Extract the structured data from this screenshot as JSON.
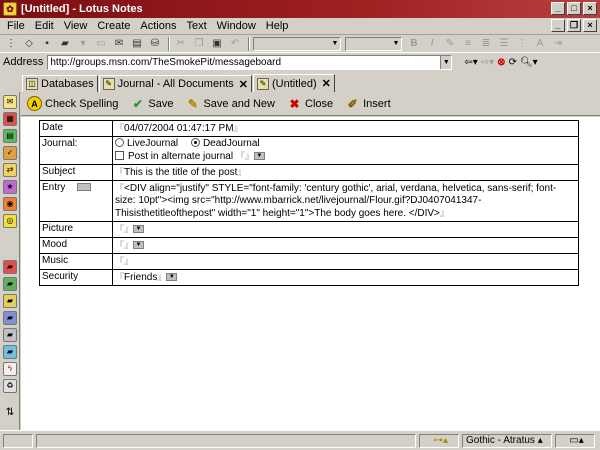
{
  "window": {
    "title": "[Untitled] - Lotus Notes"
  },
  "menu": [
    "File",
    "Edit",
    "View",
    "Create",
    "Actions",
    "Text",
    "Window",
    "Help"
  ],
  "address": {
    "label": "Address",
    "value": "http://groups.msn.com/TheSmokePit/messageboard"
  },
  "tabs": [
    {
      "label": "Databases",
      "icon": "databases-icon"
    },
    {
      "label": "Journal - All Documents",
      "icon": "journal-icon"
    },
    {
      "label": "(Untitled)",
      "icon": "document-icon"
    }
  ],
  "actions": {
    "check_spelling": "Check Spelling",
    "save": "Save",
    "save_and_new": "Save and New",
    "close": "Close",
    "insert": "Insert"
  },
  "form": {
    "date": {
      "label": "Date",
      "value": "04/07/2004 01:47:17 PM"
    },
    "journal": {
      "label": "Journal:",
      "options": [
        "LiveJournal",
        "DeadJournal"
      ],
      "selected": "DeadJournal",
      "alt_label": "Post in alternate journal"
    },
    "subject": {
      "label": "Subject",
      "value": "This is the title of the post"
    },
    "entry": {
      "label": "Entry",
      "value": "<DIV align=\"justify\" STYLE=\"font-family: 'century gothic', arial, verdana, helvetica, sans-serif; font-size: 10pt\"><img src=\"http://www.mbarrick.net/livejournal/Flour.gif?DJ0407041347-Thisisthetitleofthepost\" width=\"1\" height=\"1\">The body goes here. </DIV>"
    },
    "picture": {
      "label": "Picture",
      "value": ""
    },
    "mood": {
      "label": "Mood",
      "value": ""
    },
    "music": {
      "label": "Music",
      "value": ""
    },
    "security": {
      "label": "Security",
      "value": "Friends"
    }
  },
  "status": {
    "font": "Gothic - Atratus"
  }
}
